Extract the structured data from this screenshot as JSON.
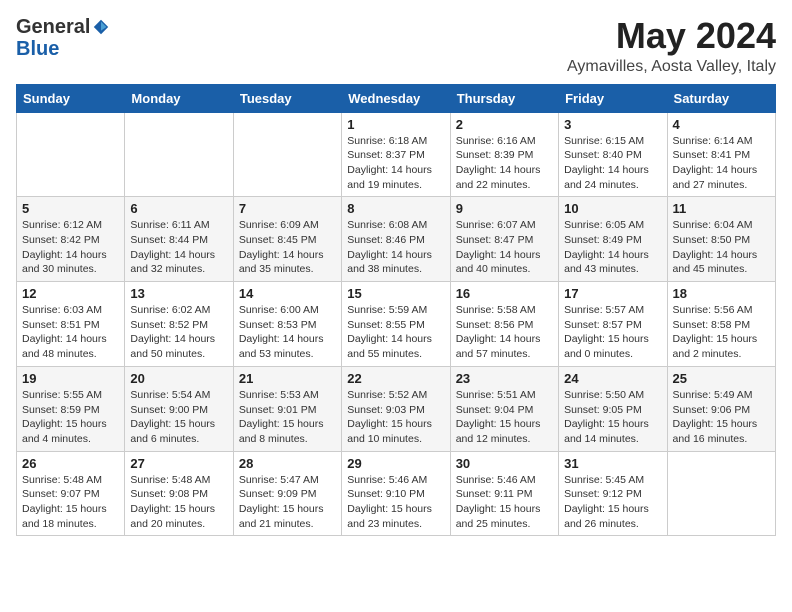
{
  "logo": {
    "general": "General",
    "blue": "Blue"
  },
  "title": "May 2024",
  "location": "Aymavilles, Aosta Valley, Italy",
  "days_of_week": [
    "Sunday",
    "Monday",
    "Tuesday",
    "Wednesday",
    "Thursday",
    "Friday",
    "Saturday"
  ],
  "weeks": [
    [
      {
        "day": "",
        "info": ""
      },
      {
        "day": "",
        "info": ""
      },
      {
        "day": "",
        "info": ""
      },
      {
        "day": "1",
        "info": "Sunrise: 6:18 AM\nSunset: 8:37 PM\nDaylight: 14 hours\nand 19 minutes."
      },
      {
        "day": "2",
        "info": "Sunrise: 6:16 AM\nSunset: 8:39 PM\nDaylight: 14 hours\nand 22 minutes."
      },
      {
        "day": "3",
        "info": "Sunrise: 6:15 AM\nSunset: 8:40 PM\nDaylight: 14 hours\nand 24 minutes."
      },
      {
        "day": "4",
        "info": "Sunrise: 6:14 AM\nSunset: 8:41 PM\nDaylight: 14 hours\nand 27 minutes."
      }
    ],
    [
      {
        "day": "5",
        "info": "Sunrise: 6:12 AM\nSunset: 8:42 PM\nDaylight: 14 hours\nand 30 minutes."
      },
      {
        "day": "6",
        "info": "Sunrise: 6:11 AM\nSunset: 8:44 PM\nDaylight: 14 hours\nand 32 minutes."
      },
      {
        "day": "7",
        "info": "Sunrise: 6:09 AM\nSunset: 8:45 PM\nDaylight: 14 hours\nand 35 minutes."
      },
      {
        "day": "8",
        "info": "Sunrise: 6:08 AM\nSunset: 8:46 PM\nDaylight: 14 hours\nand 38 minutes."
      },
      {
        "day": "9",
        "info": "Sunrise: 6:07 AM\nSunset: 8:47 PM\nDaylight: 14 hours\nand 40 minutes."
      },
      {
        "day": "10",
        "info": "Sunrise: 6:05 AM\nSunset: 8:49 PM\nDaylight: 14 hours\nand 43 minutes."
      },
      {
        "day": "11",
        "info": "Sunrise: 6:04 AM\nSunset: 8:50 PM\nDaylight: 14 hours\nand 45 minutes."
      }
    ],
    [
      {
        "day": "12",
        "info": "Sunrise: 6:03 AM\nSunset: 8:51 PM\nDaylight: 14 hours\nand 48 minutes."
      },
      {
        "day": "13",
        "info": "Sunrise: 6:02 AM\nSunset: 8:52 PM\nDaylight: 14 hours\nand 50 minutes."
      },
      {
        "day": "14",
        "info": "Sunrise: 6:00 AM\nSunset: 8:53 PM\nDaylight: 14 hours\nand 53 minutes."
      },
      {
        "day": "15",
        "info": "Sunrise: 5:59 AM\nSunset: 8:55 PM\nDaylight: 14 hours\nand 55 minutes."
      },
      {
        "day": "16",
        "info": "Sunrise: 5:58 AM\nSunset: 8:56 PM\nDaylight: 14 hours\nand 57 minutes."
      },
      {
        "day": "17",
        "info": "Sunrise: 5:57 AM\nSunset: 8:57 PM\nDaylight: 15 hours\nand 0 minutes."
      },
      {
        "day": "18",
        "info": "Sunrise: 5:56 AM\nSunset: 8:58 PM\nDaylight: 15 hours\nand 2 minutes."
      }
    ],
    [
      {
        "day": "19",
        "info": "Sunrise: 5:55 AM\nSunset: 8:59 PM\nDaylight: 15 hours\nand 4 minutes."
      },
      {
        "day": "20",
        "info": "Sunrise: 5:54 AM\nSunset: 9:00 PM\nDaylight: 15 hours\nand 6 minutes."
      },
      {
        "day": "21",
        "info": "Sunrise: 5:53 AM\nSunset: 9:01 PM\nDaylight: 15 hours\nand 8 minutes."
      },
      {
        "day": "22",
        "info": "Sunrise: 5:52 AM\nSunset: 9:03 PM\nDaylight: 15 hours\nand 10 minutes."
      },
      {
        "day": "23",
        "info": "Sunrise: 5:51 AM\nSunset: 9:04 PM\nDaylight: 15 hours\nand 12 minutes."
      },
      {
        "day": "24",
        "info": "Sunrise: 5:50 AM\nSunset: 9:05 PM\nDaylight: 15 hours\nand 14 minutes."
      },
      {
        "day": "25",
        "info": "Sunrise: 5:49 AM\nSunset: 9:06 PM\nDaylight: 15 hours\nand 16 minutes."
      }
    ],
    [
      {
        "day": "26",
        "info": "Sunrise: 5:48 AM\nSunset: 9:07 PM\nDaylight: 15 hours\nand 18 minutes."
      },
      {
        "day": "27",
        "info": "Sunrise: 5:48 AM\nSunset: 9:08 PM\nDaylight: 15 hours\nand 20 minutes."
      },
      {
        "day": "28",
        "info": "Sunrise: 5:47 AM\nSunset: 9:09 PM\nDaylight: 15 hours\nand 21 minutes."
      },
      {
        "day": "29",
        "info": "Sunrise: 5:46 AM\nSunset: 9:10 PM\nDaylight: 15 hours\nand 23 minutes."
      },
      {
        "day": "30",
        "info": "Sunrise: 5:46 AM\nSunset: 9:11 PM\nDaylight: 15 hours\nand 25 minutes."
      },
      {
        "day": "31",
        "info": "Sunrise: 5:45 AM\nSunset: 9:12 PM\nDaylight: 15 hours\nand 26 minutes."
      },
      {
        "day": "",
        "info": ""
      }
    ]
  ]
}
